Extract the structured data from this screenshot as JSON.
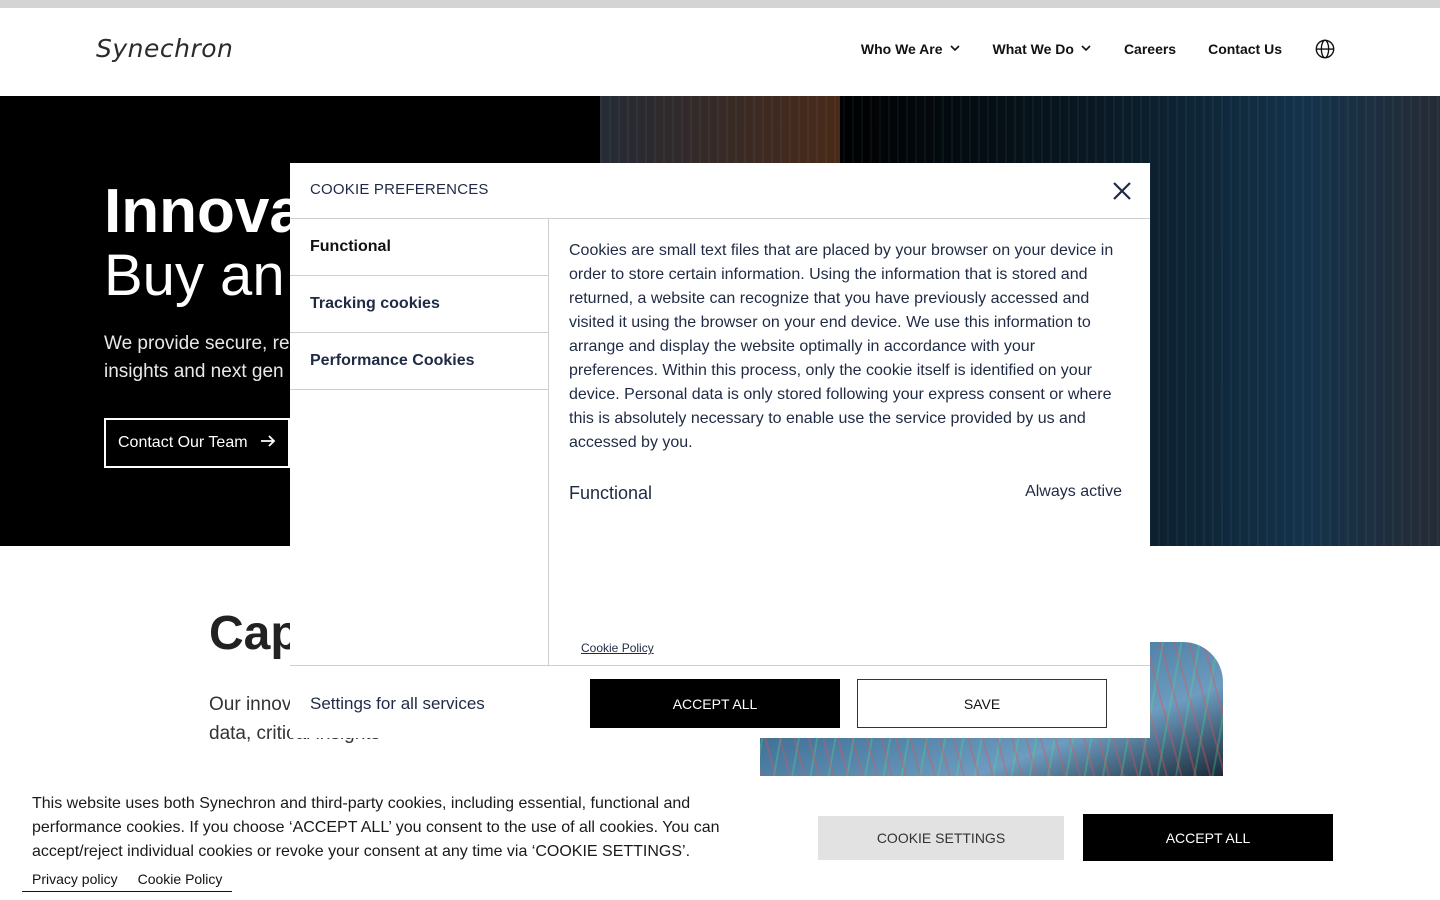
{
  "header": {
    "logo": "Synechron",
    "nav": [
      {
        "label": "Who We Are",
        "dropdown": true
      },
      {
        "label": "What We Do",
        "dropdown": true
      },
      {
        "label": "Careers"
      },
      {
        "label": "Contact Us"
      }
    ],
    "globe_icon": "globe-icon"
  },
  "hero": {
    "title_line1": "Innova",
    "title_line2": "Buy an",
    "subtitle": "We provide secure, re insights and next gen",
    "cta": "Contact Our Team"
  },
  "capabilities": {
    "title": "Cap",
    "text": "Our innov world’s le real-time trading systems, better data, critical insights"
  },
  "modal": {
    "title": "COOKIE PREFERENCES",
    "sidebar": [
      "Functional",
      "Tracking cookies",
      "Performance Cookies"
    ],
    "body": "Cookies are small text files that are placed by your browser on your device in order to store certain information. Using the information that is stored and returned, a website can recognize that you have previously accessed and visited it using the browser on your end device. We use this information to arrange and display the website optimally in accordance with your preferences. Within this process, only the cookie itself is identified on your device. Personal data is only stored following your express consent or where this is absolutely necessary to enable use the service provided by us and accessed by you.",
    "functional_label": "Functional",
    "functional_status": "Always active",
    "cookie_policy": "Cookie Policy",
    "footer_label": "Settings for all services",
    "accept_all": "ACCEPT ALL",
    "save": "SAVE"
  },
  "banner": {
    "text": "This website uses both Synechron and third-party cookies, including essential, functional and performance cookies. If you choose ‘ACCEPT ALL’ you consent to the use of all cookies. You can accept/reject individual cookies or revoke your consent at any time via ‘COOKIE SETTINGS’.",
    "privacy_policy": "Privacy policy",
    "cookie_policy": "Cookie Policy",
    "cookie_settings": "COOKIE SETTINGS",
    "accept_all": "ACCEPT ALL"
  }
}
